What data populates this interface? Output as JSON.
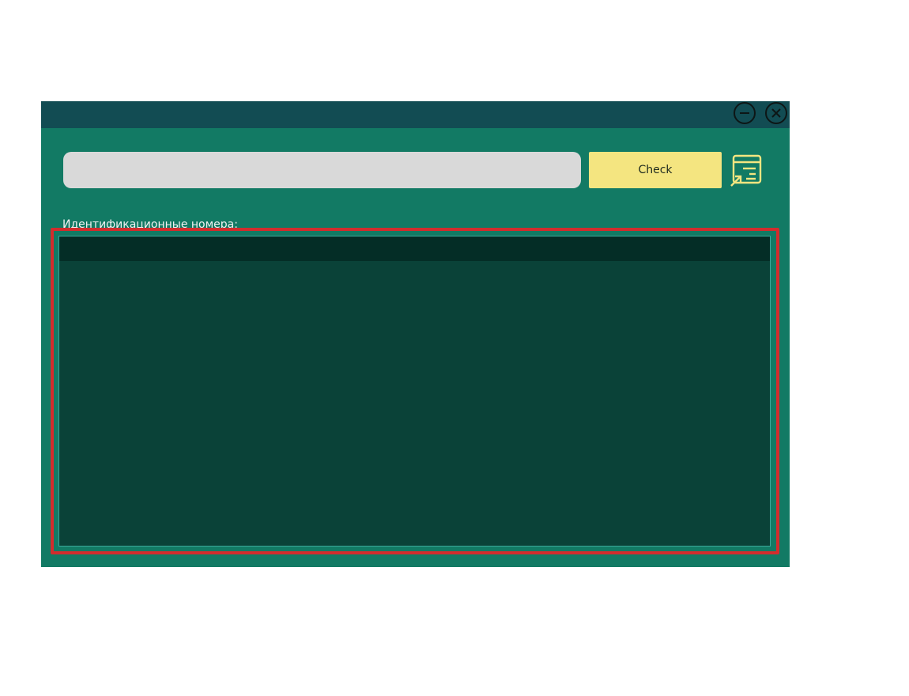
{
  "window": {
    "minimize_icon": "minus-circle-icon",
    "close_icon": "x-circle-icon"
  },
  "search": {
    "value": "",
    "placeholder": ""
  },
  "toolbar": {
    "check_label": "Check",
    "export_icon": "export-list-icon"
  },
  "ids": {
    "label": "Идентификационные номера:",
    "items": []
  },
  "colors": {
    "window_bg": "#127a64",
    "titlebar_bg": "#124c53",
    "input_bg": "#d9d9d9",
    "button_bg": "#f4e580",
    "icon_color": "#f4e580",
    "list_bg": "#0a4238",
    "list_header_bg": "#042d26",
    "highlight": "#d12d2d"
  }
}
